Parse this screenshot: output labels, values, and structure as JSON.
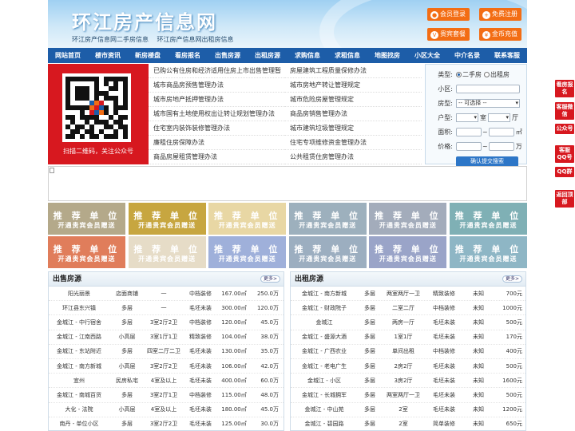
{
  "header": {
    "title": "环江房产信息网",
    "subtitle_links": [
      "环江房产信息网二手房信息",
      "环江房产信息网出租房信息"
    ],
    "buttons": {
      "login": "会员登录",
      "register": "免费注册",
      "vip": "贵宾套餐",
      "recharge": "金币充值"
    }
  },
  "nav": [
    "网站首页",
    "楼市资讯",
    "新房楼盘",
    "看房报名",
    "出售房源",
    "出租房源",
    "求购信息",
    "求租信息",
    "地图找房",
    "小区大全",
    "中介名录",
    "联系客服"
  ],
  "qr": {
    "caption": "扫描二维码，关注公众号"
  },
  "links": {
    "left": [
      "已购公有住房和经济适用住房上市出售管理暂",
      "城市商品房预售管理办法",
      "城市房地产抵押管理办法",
      "城市国有土地使用权出让转让规划管理办法",
      "住宅室内装饰装修管理办法",
      "廉租住房保障办法",
      "商品房屋租赁管理办法"
    ],
    "right": [
      "房屋建筑工程质量保修办法",
      "城市房地产转让管理规定",
      "城市危险房屋管理规定",
      "商品房销售管理办法",
      "城市建筑垃圾管理规定",
      "住宅专项维修资金管理办法",
      "公共租赁住房管理办法"
    ]
  },
  "search": {
    "type_label": "类型:",
    "type_options": [
      "二手房",
      "出租房"
    ],
    "community_label": "小区:",
    "housetype_label": "房型:",
    "housetype_value": "-- 可选择 --",
    "layout_label": "户型:",
    "room_unit": "室",
    "hall_unit": "厅",
    "area_label": "面积:",
    "area_sep": "~",
    "area_unit": "㎡",
    "price_label": "价格:",
    "price_sep": "~",
    "price_unit": "万",
    "submit": "确认提交搜索"
  },
  "recommend": {
    "title": "推 荐 单 位",
    "sub": "开通贵宾会员赠送",
    "colors": [
      "#b4a98a",
      "#c7a640",
      "#e8d7a4",
      "#9db0bd",
      "#a3acbb",
      "#7fb0b5",
      "#e07d5b",
      "#e6dcc7",
      "#9fb0da",
      "#9caec0",
      "#9aa4c8",
      "#8eb6c5"
    ]
  },
  "sale": {
    "title": "出售房源",
    "more": "更多>",
    "rows": [
      [
        "阳光丽景",
        "店面商铺",
        "一",
        "中档装修",
        "167.00㎡",
        "250.0万"
      ],
      [
        "环江县东兴镇",
        "多层",
        "一",
        "毛坯未装",
        "300.00㎡",
        "120.0万"
      ],
      [
        "金城江 - 中行宿舍",
        "多层",
        "3室2厅2卫",
        "中档装修",
        "120.00㎡",
        "45.0万"
      ],
      [
        "金城江 - 江南西路",
        "小高层",
        "3室1厅1卫",
        "精致装修",
        "104.00㎡",
        "38.0万"
      ],
      [
        "金城江 - 东站附近",
        "多层",
        "四室二厅二卫",
        "毛坯未装",
        "130.00㎡",
        "35.0万"
      ],
      [
        "金城江 - 南方新城",
        "小高层",
        "3室2厅2卫",
        "毛坯未装",
        "106.00㎡",
        "42.0万"
      ],
      [
        "宜州",
        "民房私宅",
        "4室及以上",
        "毛坯未装",
        "400.00㎡",
        "60.0万"
      ],
      [
        "金城江 - 南城百货",
        "多层",
        "3室2厅1卫",
        "中档装修",
        "115.00㎡",
        "48.0万"
      ],
      [
        "大化 - 法院",
        "小高层",
        "4室及以上",
        "毛坯未装",
        "180.00㎡",
        "45.0万"
      ],
      [
        "南丹 - 单位小区",
        "多层",
        "3室2厅2卫",
        "毛坯未装",
        "125.00㎡",
        "30.0万"
      ]
    ]
  },
  "rent": {
    "title": "出租房源",
    "more": "更多>",
    "rows": [
      [
        "金城江 - 南方新城",
        "多层",
        "两室两厅一卫",
        "精致装修",
        "未知",
        "700元"
      ],
      [
        "金城江 - 财政院子",
        "多层",
        "二室二厅",
        "中档装修",
        "未知",
        "1000元"
      ],
      [
        "金城江",
        "多层",
        "两房一厅",
        "毛坯未装",
        "未知",
        "500元"
      ],
      [
        "金城江 - 盛源大酒",
        "多层",
        "1室1厅",
        "毛坯未装",
        "未知",
        "170元"
      ],
      [
        "金城江 - 广西农业",
        "多层",
        "单间出租",
        "中档装修",
        "未知",
        "400元"
      ],
      [
        "金城江 - 老电广生",
        "多层",
        "2房2厅",
        "毛坯未装",
        "未知",
        "500元"
      ],
      [
        "金城江 - 小区",
        "多层",
        "3房2厅",
        "毛坯未装",
        "未知",
        "1600元"
      ],
      [
        "金城江 - 长城拥军",
        "多层",
        "两室两厅一卫",
        "毛坯未装",
        "未知",
        "500元"
      ],
      [
        "金城江 - 中山苑",
        "多层",
        "2室",
        "毛坯未装",
        "未知",
        "1200元"
      ],
      [
        "金城江 - 碧园路",
        "多层",
        "2室",
        "简单装修",
        "未知",
        "650元"
      ]
    ]
  },
  "float_buttons": [
    "看房报名",
    "客服微信",
    "公众号",
    "客服QQ号",
    "QQ群",
    "返回顶部"
  ]
}
